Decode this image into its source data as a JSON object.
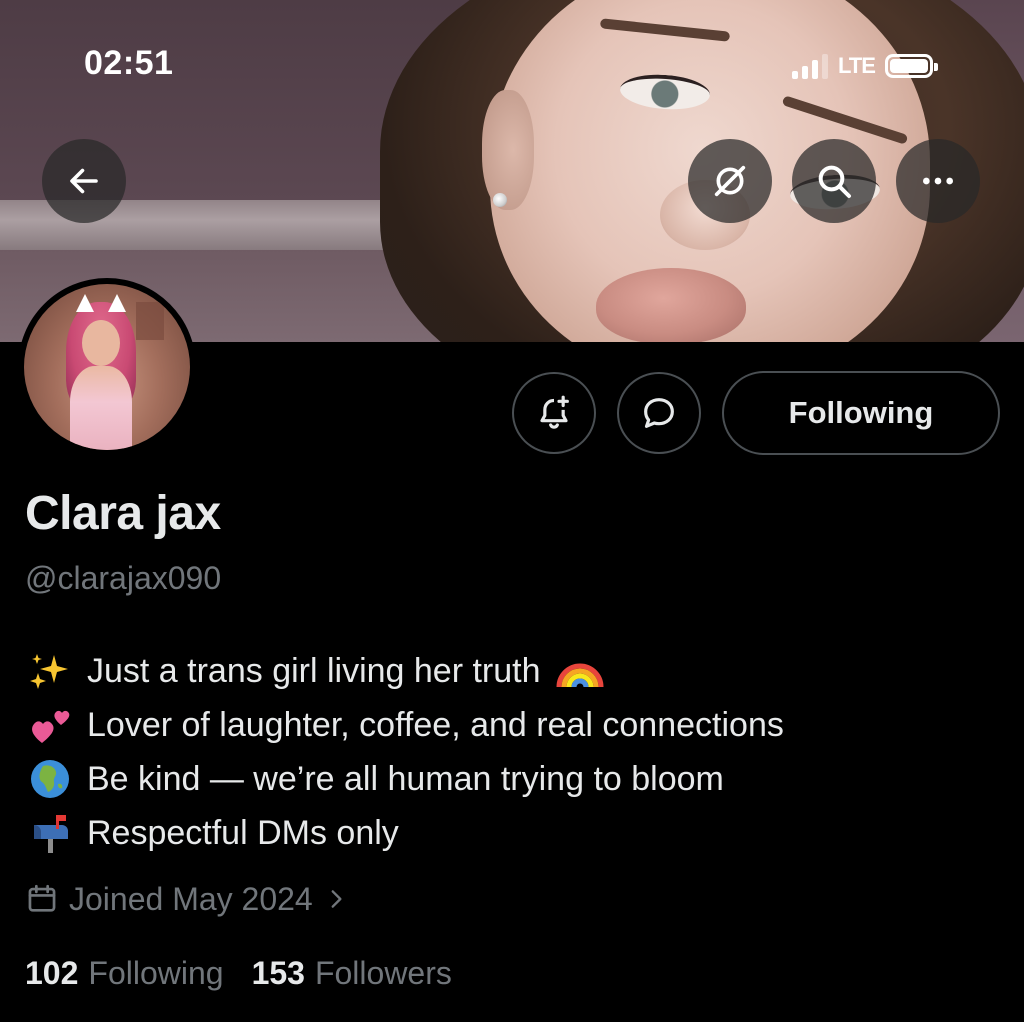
{
  "status_bar": {
    "time": "02:51",
    "network": "LTE",
    "signal_bars": 3,
    "battery_level": 1.0
  },
  "header": {
    "back_icon": "arrow-left-icon",
    "grok_icon": "grok-icon",
    "search_icon": "search-icon",
    "more_icon": "more-horizontal-icon"
  },
  "profile": {
    "display_name": "Clara jax",
    "handle": "@clarajax090",
    "bio": [
      {
        "emoji": "sparkles",
        "text": "Just a trans girl living her truth",
        "trailing_emoji": "rainbow"
      },
      {
        "emoji": "two-hearts",
        "text": "Lover of laughter, coffee, and real connections"
      },
      {
        "emoji": "globe-africa",
        "text": "Be kind — we’re all human trying to bloom"
      },
      {
        "emoji": "mailbox-flag",
        "text": "Respectful DMs only"
      }
    ],
    "joined": "Joined May 2024",
    "following_count": "102",
    "following_label": "Following",
    "followers_count": "153",
    "followers_label": "Followers"
  },
  "actions": {
    "notify_icon": "bell-plus-icon",
    "message_icon": "message-bubble-icon",
    "following_button": "Following"
  },
  "colors": {
    "background": "#000000",
    "primary_text": "#e7e9ea",
    "secondary_text": "#71767b",
    "border": "#4a4f53"
  }
}
